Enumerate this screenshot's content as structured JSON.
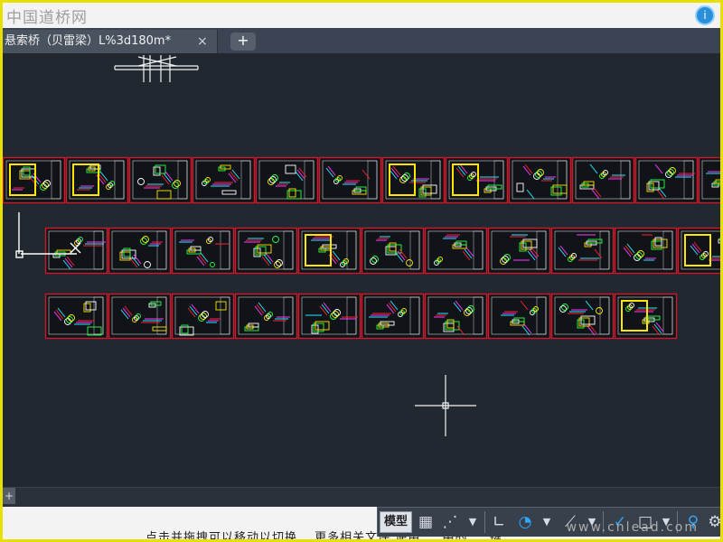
{
  "header": {
    "watermark_text": "中国道桥网",
    "help_badge_text": "i"
  },
  "tabs": [
    {
      "label": "悬索桥（贝雷梁）L%3d180m*",
      "close_icon": "×",
      "active": true
    }
  ],
  "add_tab_icon": "+",
  "status": {
    "model_label": "模型",
    "grid_icon": "grid-icon",
    "snap_icon": "snap-icon",
    "ortho_icon": "ortho-icon",
    "polar_icon": "polar-icon",
    "object_snap_icon": "object-snap-icon",
    "selection_icon": "selection-icon",
    "annotation_icon": "annotation-icon",
    "settings_icon": "settings-icon"
  },
  "bottom_text": "点击并拖拽可以移动以切换… 更多相关文件 使用 … 中的 … 键",
  "bottom_watermark": "www.cnlead.com",
  "colors": {
    "canvas": "#212830",
    "sheet_border": "#d01828",
    "cad_cyan": "#24e8ff",
    "cad_yellow": "#ffe600",
    "cad_red": "#ff1f2f",
    "cad_green": "#28ff48",
    "cad_magenta": "#ff39ff",
    "frame_yellow": "#e8e000"
  }
}
